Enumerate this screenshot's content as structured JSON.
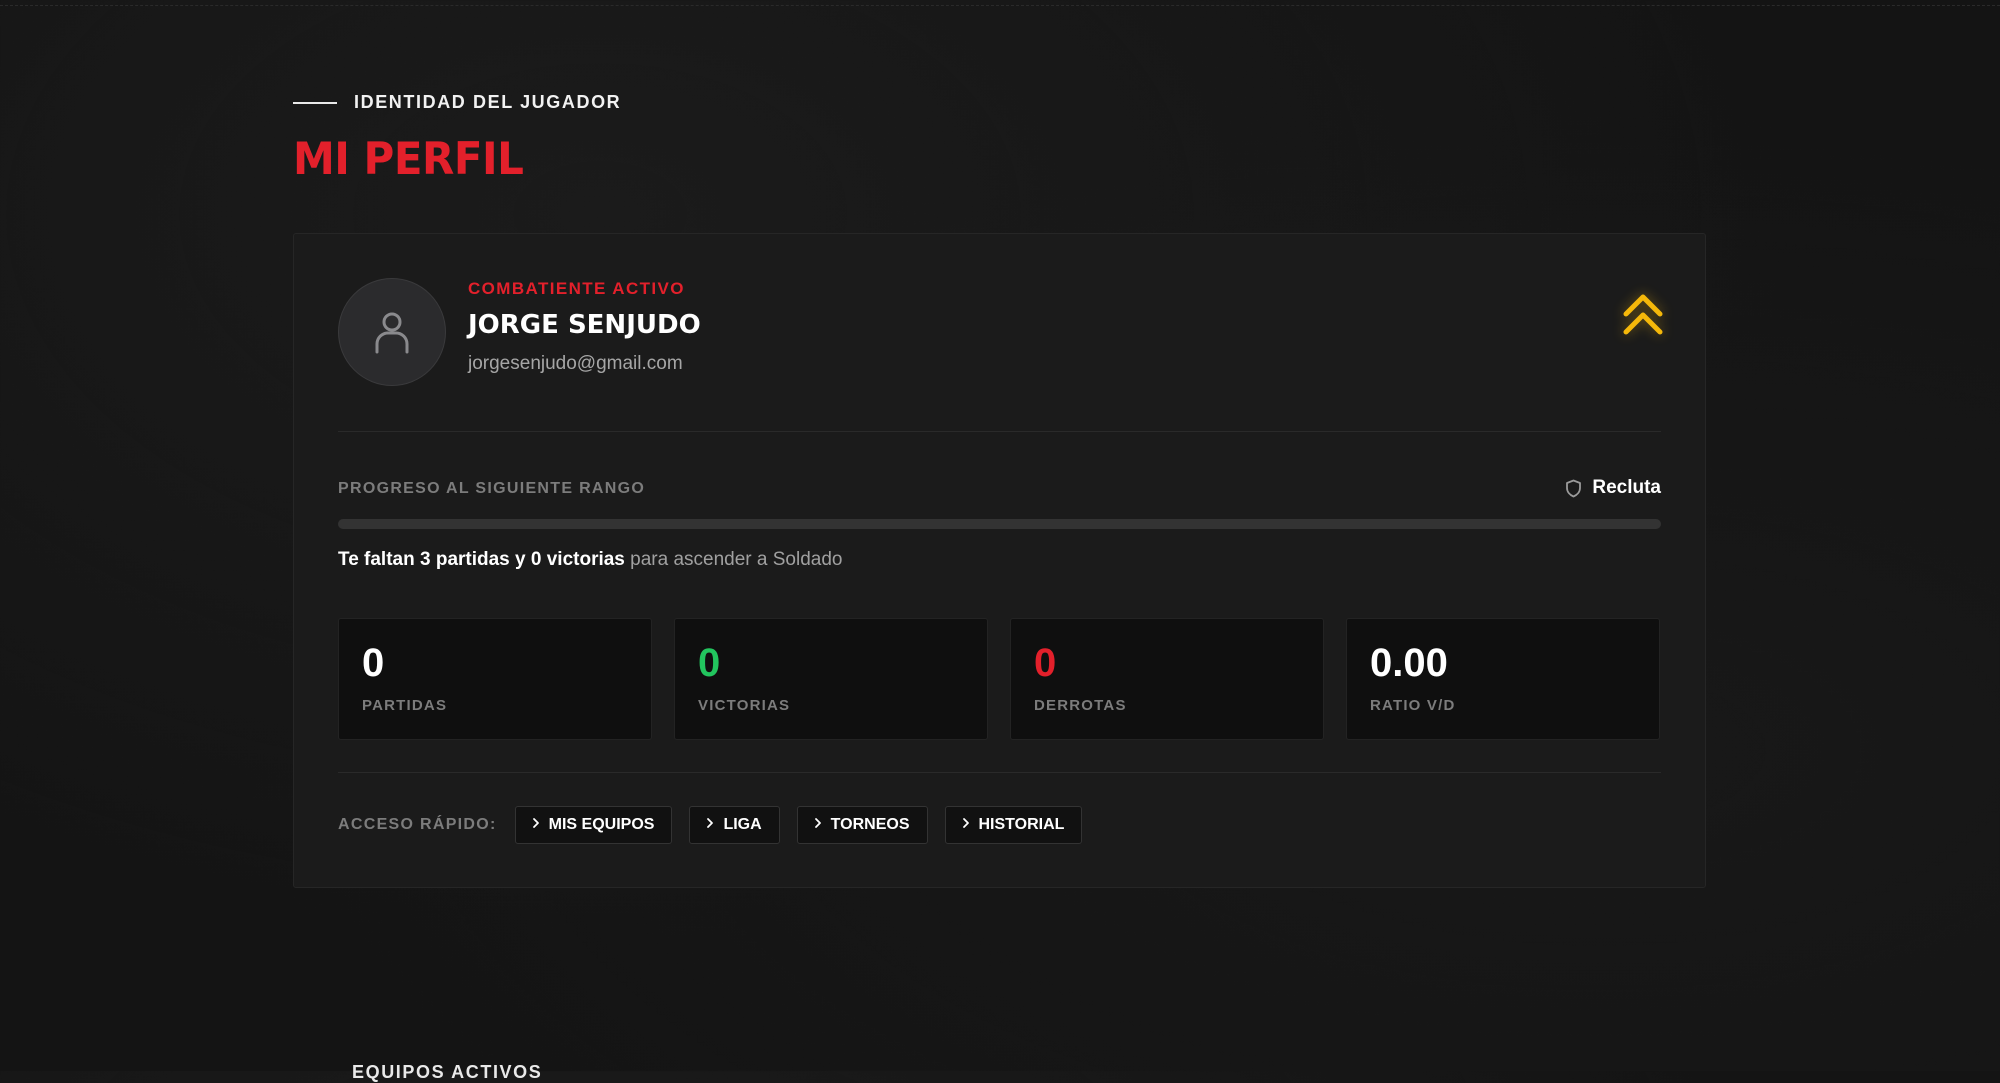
{
  "header": {
    "kicker": "IDENTIDAD DEL JUGADOR",
    "title": "MI PERFIL"
  },
  "profile": {
    "status": "COMBATIENTE ACTIVO",
    "name": "JORGE SENJUDO",
    "email": "jorgesenjudo@gmail.com",
    "avatar_icon": "user-icon",
    "rank_icon": "double-chevron-up-icon"
  },
  "progress": {
    "label": "PROGRESO AL SIGUIENTE RANGO",
    "current_rank": "Recluta",
    "current_rank_icon": "shield-icon",
    "fraction": 0,
    "note_strong": "Te faltan 3 partidas y 0 victorias",
    "note_rest": " para ascender a Soldado"
  },
  "stats": [
    {
      "value": "0",
      "label": "PARTIDAS",
      "color": "#ffffff"
    },
    {
      "value": "0",
      "label": "VICTORIAS",
      "color": "#22c55e"
    },
    {
      "value": "0",
      "label": "DERROTAS",
      "color": "#e3202b"
    },
    {
      "value": "0.00",
      "label": "RATIO V/D",
      "color": "#ffffff"
    }
  ],
  "quick_access": {
    "label": "ACCESO RÁPIDO:",
    "links": [
      "MIS EQUIPOS",
      "LIGA",
      "TORNEOS",
      "HISTORIAL"
    ]
  },
  "next_section": {
    "title": "EQUIPOS ACTIVOS"
  },
  "colors": {
    "accent": "#e3202b",
    "rank": "#f5b80a",
    "win": "#22c55e"
  }
}
